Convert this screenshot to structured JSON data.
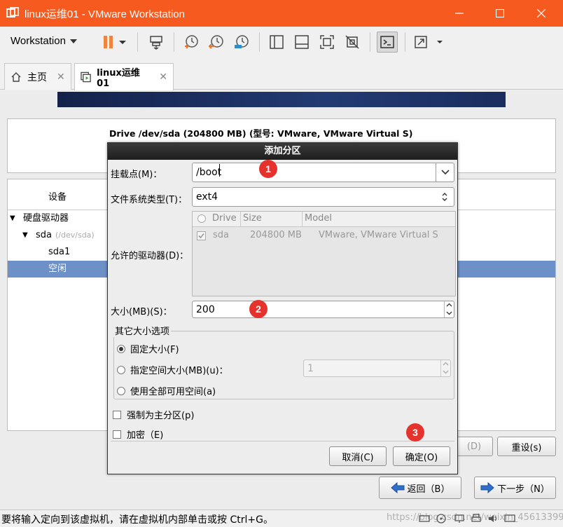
{
  "window": {
    "title": "linux运维01 - VMware Workstation"
  },
  "toolbar": {
    "workstation_menu": "Workstation"
  },
  "tabs": [
    {
      "label": "主页"
    },
    {
      "label": "linux运维01"
    }
  ],
  "installer": {
    "drive_title": "Drive /dev/sda (204800 MB) (型号: VMware, VMware Virtual S)",
    "tree_header_device": "设备",
    "tree_items": [
      {
        "label": "硬盘驱动器"
      },
      {
        "label": "sda",
        "sub": "(/dev/sda)"
      },
      {
        "label": "sda1"
      },
      {
        "label": "空闲"
      }
    ],
    "hidden_button_partial": "(D)",
    "reset_button": "重设(s)",
    "back_button": "返回（B）",
    "next_button": "下一步（N）"
  },
  "dialog": {
    "title": "添加分区",
    "mount_label": "挂载点(M)：",
    "mount_value": "/boot",
    "fstype_label": "文件系统类型(T)：",
    "fstype_value": "ext4",
    "drives_label": "允许的驱动器(D)：",
    "drives_columns": [
      "Drive",
      "Size",
      "Model"
    ],
    "drives_rows": [
      {
        "drive": "sda",
        "size": "204800 MB",
        "model": "VMware, VMware Virtual S"
      }
    ],
    "size_label": "大小(MB)(S)：",
    "size_value": "200",
    "other_size_group": "其它大小选项",
    "opt_fixed": "固定大小(F)",
    "opt_upto": "指定空间大小(MB)(u)：",
    "opt_upto_value": "1",
    "opt_fill": "使用全部可用空间(a)",
    "force_primary": "强制为主分区(p)",
    "encrypt": "加密（E)",
    "cancel": "取消(C)",
    "ok": "确定(O)"
  },
  "badges": [
    "1",
    "2",
    "3"
  ],
  "statusbar": {
    "message": "要将输入定向到该虚拟机，请在虚拟机内部单击或按 Ctrl+G。",
    "watermark": "https://blog.csdn.net/weixin_45613399"
  },
  "colors": {
    "titlebar": "#f65a1e",
    "selection": "#6e90c8",
    "badge": "#e5322d"
  }
}
